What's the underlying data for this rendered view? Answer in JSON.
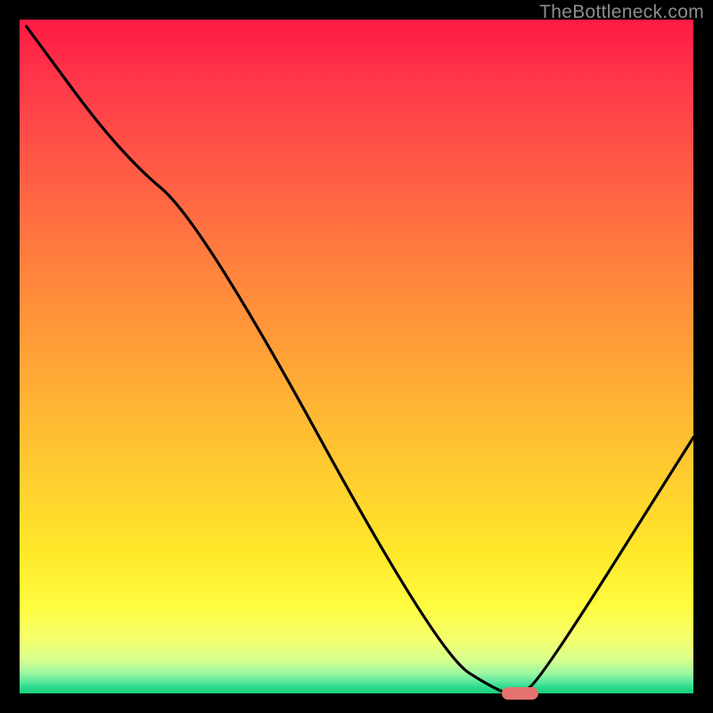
{
  "watermark": "TheBottleneck.com",
  "chart_data": {
    "type": "line",
    "title": "",
    "xlabel": "",
    "ylabel": "",
    "xlim": [
      0,
      100
    ],
    "ylim": [
      0,
      100
    ],
    "series": [
      {
        "name": "curve",
        "x": [
          1,
          15,
          27,
          62,
          71.5,
          74,
          77,
          100
        ],
        "values": [
          99,
          80,
          70,
          6,
          0,
          0,
          1.5,
          38
        ]
      }
    ],
    "marker": {
      "x_start": 71.5,
      "x_end": 77,
      "y": 0
    },
    "colors": {
      "background_top": "#ff1a45",
      "background_bottom": "#17d07a",
      "curve": "#000000",
      "marker": "#e5736f",
      "frame": "#000000"
    }
  }
}
